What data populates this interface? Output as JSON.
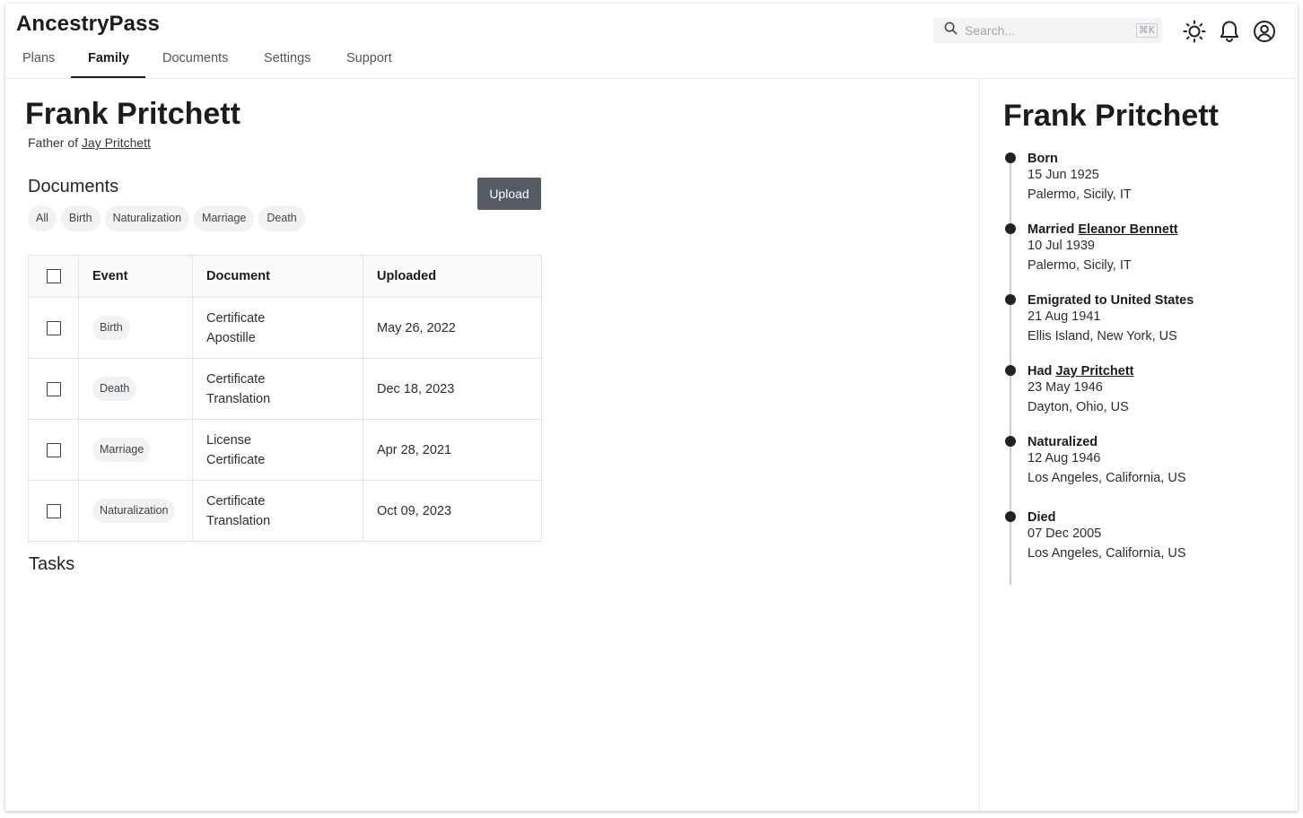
{
  "app": {
    "name": "AncestryPass"
  },
  "nav": {
    "tabs": [
      {
        "label": "Plans"
      },
      {
        "label": "Family"
      },
      {
        "label": "Documents"
      },
      {
        "label": "Settings"
      },
      {
        "label": "Support"
      }
    ],
    "active": "Family"
  },
  "search": {
    "placeholder": "Search...",
    "shortcut": "⌘K"
  },
  "header_icons": [
    "sun-icon",
    "bell-icon",
    "user-circle-icon"
  ],
  "person": {
    "name": "Frank Pritchett",
    "relation_prefix": "Father of",
    "relation_link": "Jay Pritchett"
  },
  "documents": {
    "title": "Documents",
    "upload_label": "Upload",
    "filters": [
      "All",
      "Birth",
      "Naturalization",
      "Marriage",
      "Death"
    ],
    "columns": {
      "event": "Event",
      "document": "Document",
      "uploaded": "Uploaded"
    },
    "rows": [
      {
        "event": "Birth",
        "doc_line1": "Certificate",
        "doc_line2": "Apostille",
        "uploaded": "May 26, 2022"
      },
      {
        "event": "Death",
        "doc_line1": "Certificate",
        "doc_line2": "Translation",
        "uploaded": "Dec 18, 2023"
      },
      {
        "event": "Marriage",
        "doc_line1": "License",
        "doc_line2": "Certificate",
        "uploaded": "Apr 28, 2021"
      },
      {
        "event": "Naturalization",
        "doc_line1": "Certificate",
        "doc_line2": "Translation",
        "uploaded": "Oct 09, 2023"
      }
    ]
  },
  "tasks": {
    "title": "Tasks"
  },
  "timeline": {
    "name": "Frank Pritchett",
    "events": [
      {
        "title": "Born",
        "link": "",
        "date": "15 Jun 1925",
        "place": "Palermo, Sicily, IT"
      },
      {
        "title": "Married",
        "link": "Eleanor Bennett",
        "date": "10 Jul 1939",
        "place": "Palermo, Sicily, IT"
      },
      {
        "title": "Emigrated to United States",
        "link": "",
        "date": "21 Aug 1941",
        "place": "Ellis Island, New York, US"
      },
      {
        "title": "Had",
        "link": "Jay Pritchett",
        "date": "23 May 1946",
        "place": "Dayton, Ohio, US"
      },
      {
        "title": "Naturalized",
        "link": "",
        "date": "12 Aug 1946",
        "place": "Los Angeles, California, US"
      },
      {
        "title": "Died",
        "link": "",
        "date": "07 Dec 2005",
        "place": "Los Angeles, California, US"
      }
    ]
  },
  "colors": {
    "primary_button": "#555b62",
    "text": "#1a1c1e",
    "chip_bg": "#f1f2f3"
  }
}
